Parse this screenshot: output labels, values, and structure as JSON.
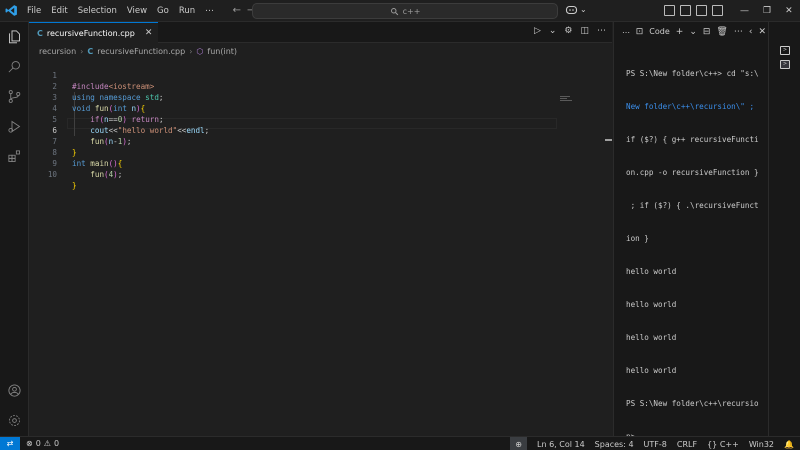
{
  "menu": [
    "File",
    "Edit",
    "Selection",
    "View",
    "Go",
    "Run",
    "⋯"
  ],
  "search": {
    "text": "c++"
  },
  "window_controls": {
    "minimize": "—",
    "restore": "❐",
    "close": "✕"
  },
  "tab": {
    "label": "recursiveFunction.cpp",
    "icon": "C",
    "close": "✕"
  },
  "breadcrumb": {
    "folder": "recursion",
    "file": "recursiveFunction.cpp",
    "symbol": "fun(int)"
  },
  "code_lines": [
    "#include<iostream>",
    "using namespace std;",
    "void fun(int n){",
    "    if(n==0) return;",
    "    cout<<\"hello world\"<<endl;",
    "    fun(n-1);",
    "}",
    "int main(){",
    "    fun(4);",
    "}"
  ],
  "line_numbers": [
    "1",
    "2",
    "3",
    "4",
    "5",
    "6",
    "7",
    "8",
    "9",
    "10"
  ],
  "terminal": {
    "header_more": "⋯",
    "label": "Code",
    "lines": [
      "PS S:\\New folder\\c++> cd \"s:\\",
      "New folder\\c++\\recursion\\\" ;",
      "if ($?) { g++ recursiveFuncti",
      "on.cpp -o recursiveFunction }",
      " ; if ($?) { .\\recursiveFunct",
      "ion }",
      "hello world",
      "hello world",
      "hello world",
      "hello world",
      "PS S:\\New folder\\c++\\recursio",
      "n>"
    ]
  },
  "status": {
    "errors": "0",
    "warnings": "0",
    "position": "Ln 6, Col 14",
    "spaces": "Spaces: 4",
    "encoding": "UTF-8",
    "eol": "CRLF",
    "language": "C++",
    "platform": "Win32"
  },
  "colors": {
    "accent": "#0078d4",
    "background": "#1f1f1f"
  }
}
